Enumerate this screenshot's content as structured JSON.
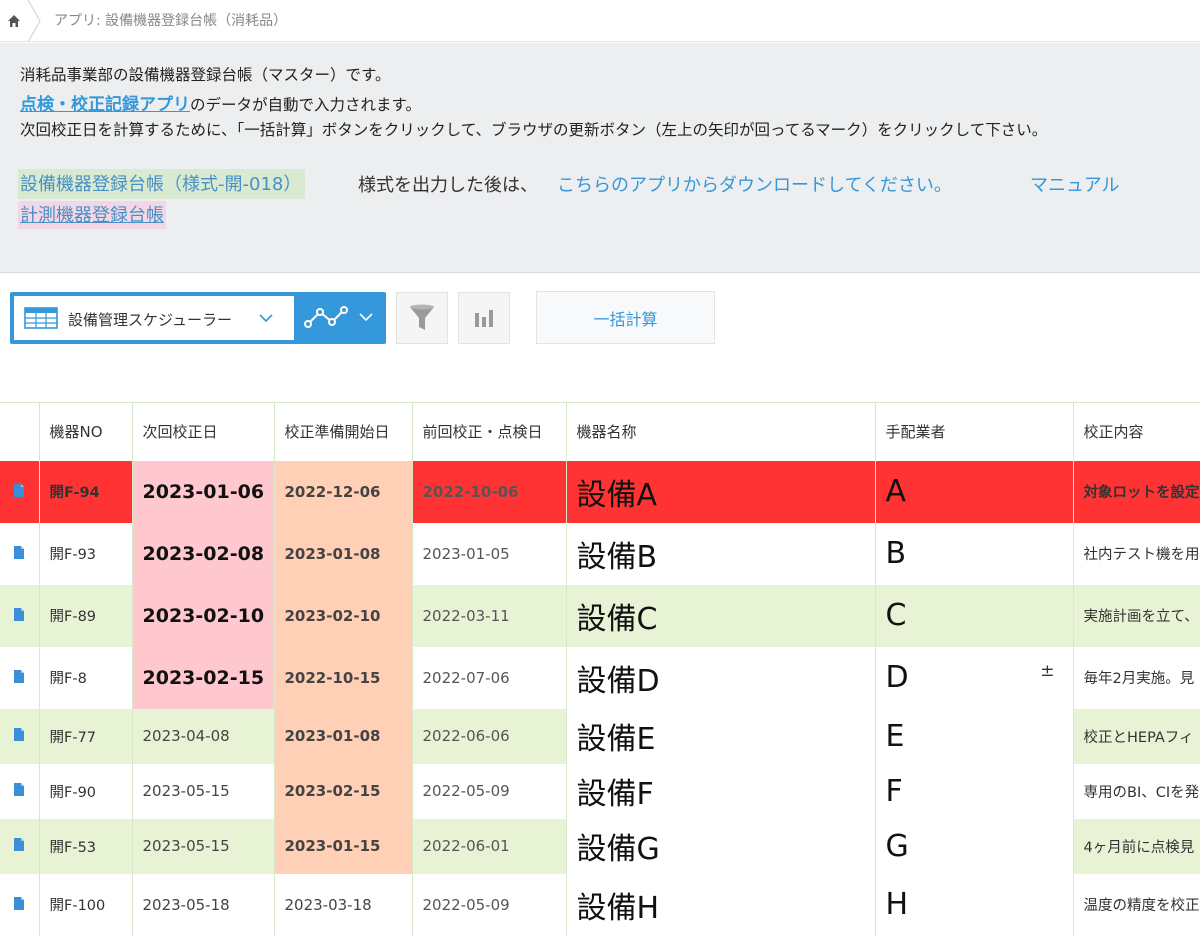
{
  "breadcrumb": {
    "title": "アプリ: 設備機器登録台帳（消耗品）"
  },
  "notice": {
    "line1": "消耗品事業部の設備機器登録台帳（マスター）です。",
    "line2_link": "点検・校正記録アプリ",
    "line2_rest": "のデータが自動で入力されます。",
    "line3": "次回校正日を計算するために、「一括計算」ボタンをクリックして、ブラウザの更新ボタン（左上の矢印が回ってるマーク）をクリックして下さい。",
    "form_link": "設備機器登録台帳（様式-開-018）",
    "form_text": "様式を出力した後は、",
    "download_link": "こちらのアプリからダウンロードしてください。",
    "manual_link": "マニュアル",
    "measure_link": "計測機器登録台帳"
  },
  "toolbar": {
    "view_label": "設備管理スケジューラー",
    "bulk_calc": "一括計算"
  },
  "colors": {
    "accent": "#3498db",
    "overdue_red": "#ff3333",
    "pink": "#ffc7ce",
    "peach": "#ffd0b5",
    "stripe_green": "#e8f3d6"
  },
  "table": {
    "headers": [
      "機器NO",
      "次回校正日",
      "校正準備開始日",
      "前回校正・点検日",
      "機器名称",
      "手配業者",
      "校正内容"
    ],
    "rows": [
      {
        "no": "開F-94",
        "next": "2023-01-06",
        "prep": "2022-12-06",
        "prev": "2022-10-06",
        "name": "設備A",
        "vendor": "A",
        "content": "対象ロットを設定"
      },
      {
        "no": "開F-93",
        "next": "2023-02-08",
        "prep": "2023-01-08",
        "prev": "2023-01-05",
        "name": "設備B",
        "vendor": "B",
        "content": "社内テスト機を用"
      },
      {
        "no": "開F-89",
        "next": "2023-02-10",
        "prep": "2023-02-10",
        "prev": "2022-03-11",
        "name": "設備C",
        "vendor": "C",
        "content": "実施計画を立て、"
      },
      {
        "no": "開F-8",
        "next": "2023-02-15",
        "prep": "2022-10-15",
        "prev": "2022-07-06",
        "name": "設備D",
        "vendor": "D",
        "vendor_mark": "±",
        "content": "毎年2月実施。見"
      },
      {
        "no": "開F-77",
        "next": "2023-04-08",
        "prep": "2023-01-08",
        "prev": "2022-06-06",
        "name": "設備E",
        "vendor": "E",
        "content": "校正とHEPAフィ"
      },
      {
        "no": "開F-90",
        "next": "2023-05-15",
        "prep": "2023-02-15",
        "prev": "2022-05-09",
        "name": "設備F",
        "vendor": "F",
        "content": "専用のBI、CIを発"
      },
      {
        "no": "開F-53",
        "next": "2023-05-15",
        "prep": "2023-01-15",
        "prev": "2022-06-01",
        "name": "設備G",
        "vendor": "G",
        "content": "4ヶ月前に点検見"
      },
      {
        "no": "開F-100",
        "next": "2023-05-18",
        "prep": "2023-03-18",
        "prev": "2022-05-09",
        "name": "設備H",
        "vendor": "H",
        "content": "温度の精度を校正"
      }
    ]
  }
}
